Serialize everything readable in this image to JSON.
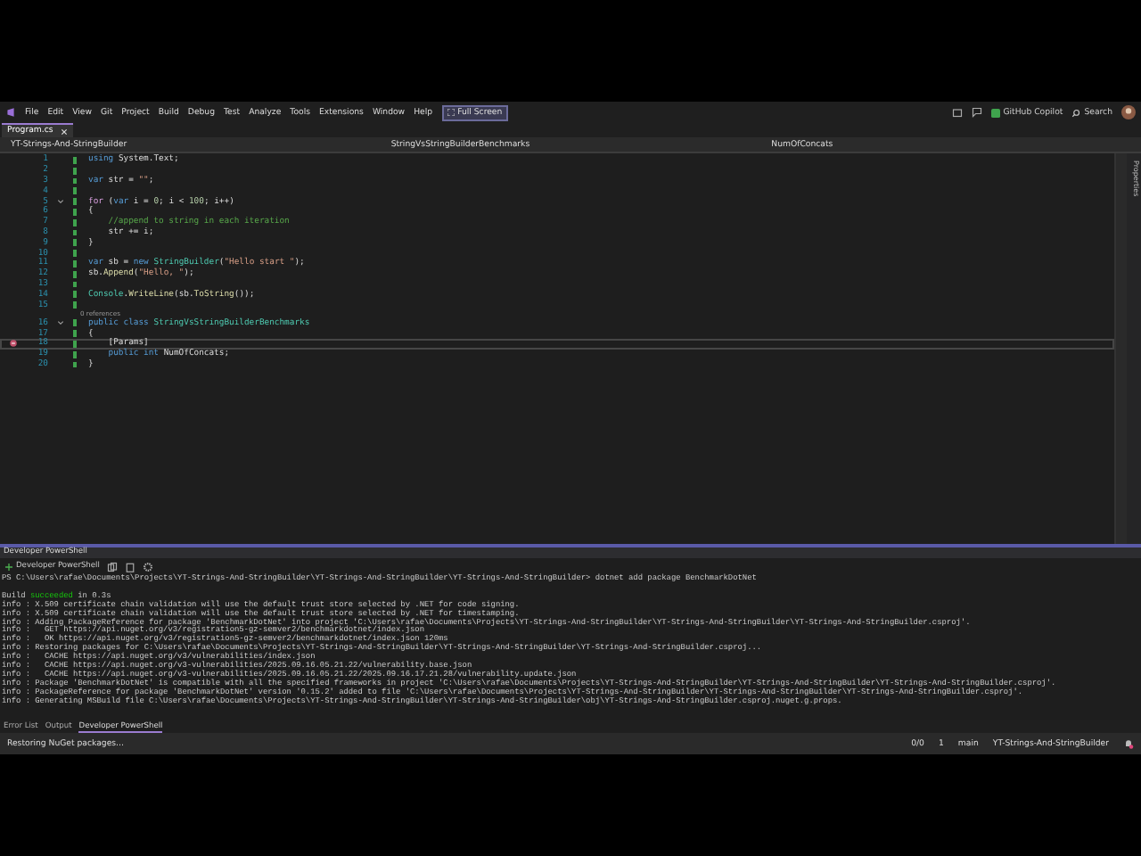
{
  "menu": [
    "File",
    "Edit",
    "View",
    "Git",
    "Project",
    "Build",
    "Debug",
    "Test",
    "Analyze",
    "Tools",
    "Extensions",
    "Window",
    "Help"
  ],
  "full_screen": "Full Screen",
  "title_bar": {
    "copilot": "GitHub Copilot",
    "search": "Search"
  },
  "document_tabs": [
    {
      "label": "Program.cs",
      "selected": true
    }
  ],
  "nav_bar": {
    "project": "YT-Strings-And-StringBuilder",
    "type": "StringVsStringBuilderBenchmarks",
    "member": "NumOfConcats"
  },
  "editor": {
    "lines": [
      {
        "number": "1",
        "current": false,
        "foldable": false,
        "quick_action": false,
        "tokens": [
          {
            "kind": "kw",
            "text": "using"
          },
          {
            "kind": "plain",
            "text": " System.Text;"
          }
        ]
      },
      {
        "number": "2",
        "current": false,
        "foldable": false,
        "quick_action": false
      },
      {
        "number": "3",
        "current": false,
        "foldable": false,
        "quick_action": false,
        "tokens": [
          {
            "kind": "kw",
            "text": "var"
          },
          {
            "kind": "plain",
            "text": " str = "
          },
          {
            "kind": "str",
            "text": "\"\""
          },
          {
            "kind": "plain",
            "text": ";"
          }
        ]
      },
      {
        "number": "4",
        "current": false,
        "foldable": false,
        "quick_action": false
      },
      {
        "number": "5",
        "current": false,
        "foldable": true,
        "quick_action": false,
        "tokens": [
          {
            "kind": "ctrl",
            "text": "for"
          },
          {
            "kind": "plain",
            "text": " ("
          },
          {
            "kind": "kw",
            "text": "var"
          },
          {
            "kind": "plain",
            "text": " i = "
          },
          {
            "kind": "num",
            "text": "0"
          },
          {
            "kind": "plain",
            "text": "; i < "
          },
          {
            "kind": "num",
            "text": "100"
          },
          {
            "kind": "plain",
            "text": "; i++)"
          }
        ]
      },
      {
        "number": "6",
        "current": false,
        "foldable": false,
        "quick_action": false,
        "tokens": [
          {
            "kind": "plain",
            "text": "{"
          }
        ]
      },
      {
        "number": "7",
        "current": false,
        "foldable": false,
        "quick_action": false,
        "indented": true,
        "tokens": [
          {
            "kind": "cmt",
            "text": "//append to string in each iteration"
          }
        ]
      },
      {
        "number": "8",
        "current": false,
        "foldable": false,
        "quick_action": false,
        "indented": true,
        "tokens": [
          {
            "kind": "plain",
            "text": "str += i;"
          }
        ]
      },
      {
        "number": "9",
        "current": false,
        "foldable": false,
        "quick_action": false,
        "tokens": [
          {
            "kind": "plain",
            "text": "}"
          }
        ]
      },
      {
        "number": "10",
        "current": false,
        "foldable": false,
        "quick_action": false
      },
      {
        "number": "11",
        "current": false,
        "foldable": false,
        "quick_action": false,
        "tokens": [
          {
            "kind": "kw",
            "text": "var"
          },
          {
            "kind": "plain",
            "text": " sb = "
          },
          {
            "kind": "kw",
            "text": "new "
          },
          {
            "kind": "type",
            "text": "StringBuilder"
          },
          {
            "kind": "plain",
            "text": "("
          },
          {
            "kind": "str",
            "text": "\"Hello start \""
          },
          {
            "kind": "plain",
            "text": ");"
          }
        ]
      },
      {
        "number": "12",
        "current": false,
        "foldable": false,
        "quick_action": false,
        "tokens": [
          {
            "kind": "plain",
            "text": "sb."
          },
          {
            "kind": "method",
            "text": "Append"
          },
          {
            "kind": "plain",
            "text": "("
          },
          {
            "kind": "str",
            "text": "\"Hello, \""
          },
          {
            "kind": "plain",
            "text": ");"
          }
        ]
      },
      {
        "number": "13",
        "current": false,
        "foldable": false,
        "quick_action": false
      },
      {
        "number": "14",
        "current": false,
        "foldable": false,
        "quick_action": false,
        "tokens": [
          {
            "kind": "type",
            "text": "Console"
          },
          {
            "kind": "plain",
            "text": "."
          },
          {
            "kind": "method",
            "text": "WriteLine"
          },
          {
            "kind": "plain",
            "text": "(sb."
          },
          {
            "kind": "method",
            "text": "ToString"
          },
          {
            "kind": "plain",
            "text": "());"
          }
        ]
      },
      {
        "number": "15",
        "current": false,
        "foldable": false,
        "quick_action": false
      },
      {
        "number": "16",
        "codelens": "0 references",
        "current": false,
        "foldable": true,
        "quick_action": false,
        "tokens": [
          {
            "kind": "kw",
            "text": "public class "
          },
          {
            "kind": "type",
            "text": "StringVsStringBuilderBenchmarks"
          }
        ]
      },
      {
        "number": "17",
        "current": false,
        "foldable": false,
        "quick_action": false,
        "tokens": [
          {
            "kind": "plain",
            "text": "{"
          }
        ]
      },
      {
        "number": "18",
        "current": true,
        "foldable": false,
        "quick_action": true,
        "indented": true,
        "tokens": [
          {
            "kind": "plain",
            "text": "[Params]"
          }
        ]
      },
      {
        "number": "19",
        "current": false,
        "foldable": false,
        "quick_action": false,
        "indented": true,
        "tokens": [
          {
            "kind": "kw",
            "text": "public int"
          },
          {
            "kind": "plain",
            "text": " NumOfConcats;"
          }
        ]
      },
      {
        "number": "20",
        "current": false,
        "foldable": false,
        "quick_action": false,
        "tokens": [
          {
            "kind": "plain",
            "text": "}"
          }
        ]
      }
    ]
  },
  "terminal": {
    "title": "Developer PowerShell",
    "profile": "Developer PowerShell",
    "lines": [
      {
        "kind": "prompt",
        "text": "PS C:\\Users\\rafae\\Documents\\Projects\\YT-Strings-And-StringBuilder\\YT-Strings-And-StringBuilder\\YT-Strings-And-StringBuilder> dotnet add package BenchmarkDotNet"
      },
      {
        "kind": "build",
        "text": "Build",
        "status": "succeeded",
        "after": "in 0.3s"
      },
      {
        "kind": "info",
        "text": "info : X.509 certificate chain validation will use the default trust store selected by .NET for code signing."
      },
      {
        "kind": "info",
        "text": "info : X.509 certificate chain validation will use the default trust store selected by .NET for timestamping."
      },
      {
        "kind": "info",
        "text": "info : Adding PackageReference for package 'BenchmarkDotNet' into project 'C:\\Users\\rafae\\Documents\\Projects\\YT-Strings-And-StringBuilder\\YT-Strings-And-StringBuilder\\YT-Strings-And-StringBuilder.csproj'."
      },
      {
        "kind": "info",
        "text": "info :   GET https://api.nuget.org/v3/registration5-gz-semver2/benchmarkdotnet/index.json"
      },
      {
        "kind": "info",
        "text": "info :   OK https://api.nuget.org/v3/registration5-gz-semver2/benchmarkdotnet/index.json 120ms"
      },
      {
        "kind": "info",
        "text": "info : Restoring packages for C:\\Users\\rafae\\Documents\\Projects\\YT-Strings-And-StringBuilder\\YT-Strings-And-StringBuilder\\YT-Strings-And-StringBuilder.csproj..."
      },
      {
        "kind": "info",
        "text": "info :   CACHE https://api.nuget.org/v3/vulnerabilities/index.json"
      },
      {
        "kind": "info",
        "text": "info :   CACHE https://api.nuget.org/v3-vulnerabilities/2025.09.16.05.21.22/vulnerability.base.json"
      },
      {
        "kind": "info",
        "text": "info :   CACHE https://api.nuget.org/v3-vulnerabilities/2025.09.16.05.21.22/2025.09.16.17.21.28/vulnerability.update.json"
      },
      {
        "kind": "info",
        "text": "info : Package 'BenchmarkDotNet' is compatible with all the specified frameworks in project 'C:\\Users\\rafae\\Documents\\Projects\\YT-Strings-And-StringBuilder\\YT-Strings-And-StringBuilder\\YT-Strings-And-StringBuilder.csproj'."
      },
      {
        "kind": "info",
        "text": "info : PackageReference for package 'BenchmarkDotNet' version '0.15.2' added to file 'C:\\Users\\rafae\\Documents\\Projects\\YT-Strings-And-StringBuilder\\YT-Strings-And-StringBuilder\\YT-Strings-And-StringBuilder.csproj'."
      },
      {
        "kind": "info",
        "text": "info : Generating MSBuild file C:\\Users\\rafae\\Documents\\Projects\\YT-Strings-And-StringBuilder\\YT-Strings-And-StringBuilder\\obj\\YT-Strings-And-StringBuilder.csproj.nuget.g.props."
      }
    ]
  },
  "panel_tabs": [
    {
      "label": "Error List",
      "selected": false
    },
    {
      "label": "Output",
      "selected": false
    },
    {
      "label": "Developer PowerShell",
      "selected": true
    }
  ],
  "side_panel": "Properties",
  "status_bar": {
    "message": "Restoring NuGet packages...",
    "changes": "0/0",
    "edits": "1",
    "branch": "main",
    "repository": "YT-Strings-And-StringBuilder"
  }
}
